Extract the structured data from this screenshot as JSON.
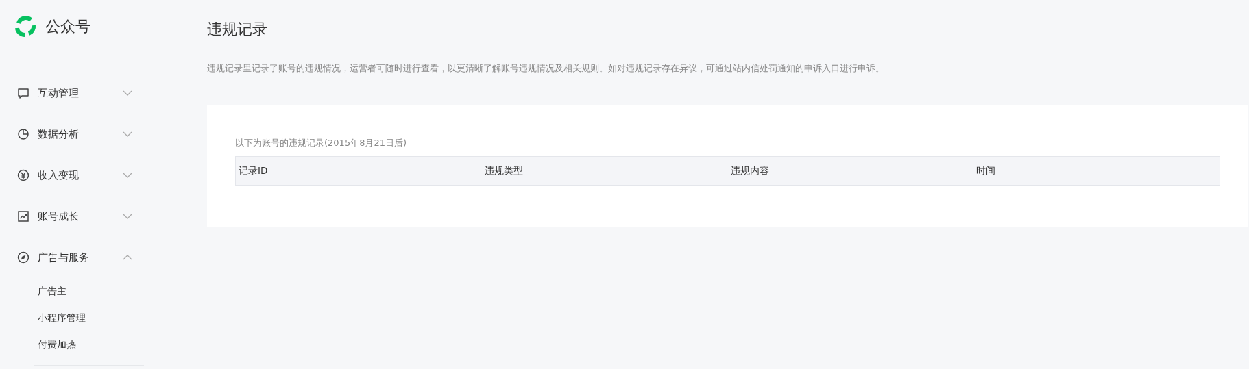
{
  "brand": {
    "name": "公众号"
  },
  "sidebar": {
    "items": [
      {
        "label": "互动管理",
        "expanded": false
      },
      {
        "label": "数据分析",
        "expanded": false
      },
      {
        "label": "收入变现",
        "expanded": false
      },
      {
        "label": "账号成长",
        "expanded": false
      },
      {
        "label": "广告与服务",
        "expanded": true,
        "children": [
          {
            "label": "广告主"
          },
          {
            "label": "小程序管理"
          },
          {
            "label": "付费加热"
          }
        ]
      }
    ]
  },
  "page": {
    "title": "违规记录",
    "description": "违规记录里记录了账号的违规情况，运营者可随时进行查看，以更清晰了解账号违规情况及相关规则。如对违规记录存在异议，可通过站内信处罚通知的申诉入口进行申诉。"
  },
  "card": {
    "caption": "以下为账号的违规记录(2015年8月21日后)",
    "table": {
      "columns": [
        "记录ID",
        "违规类型",
        "违规内容",
        "时间"
      ]
    }
  }
}
